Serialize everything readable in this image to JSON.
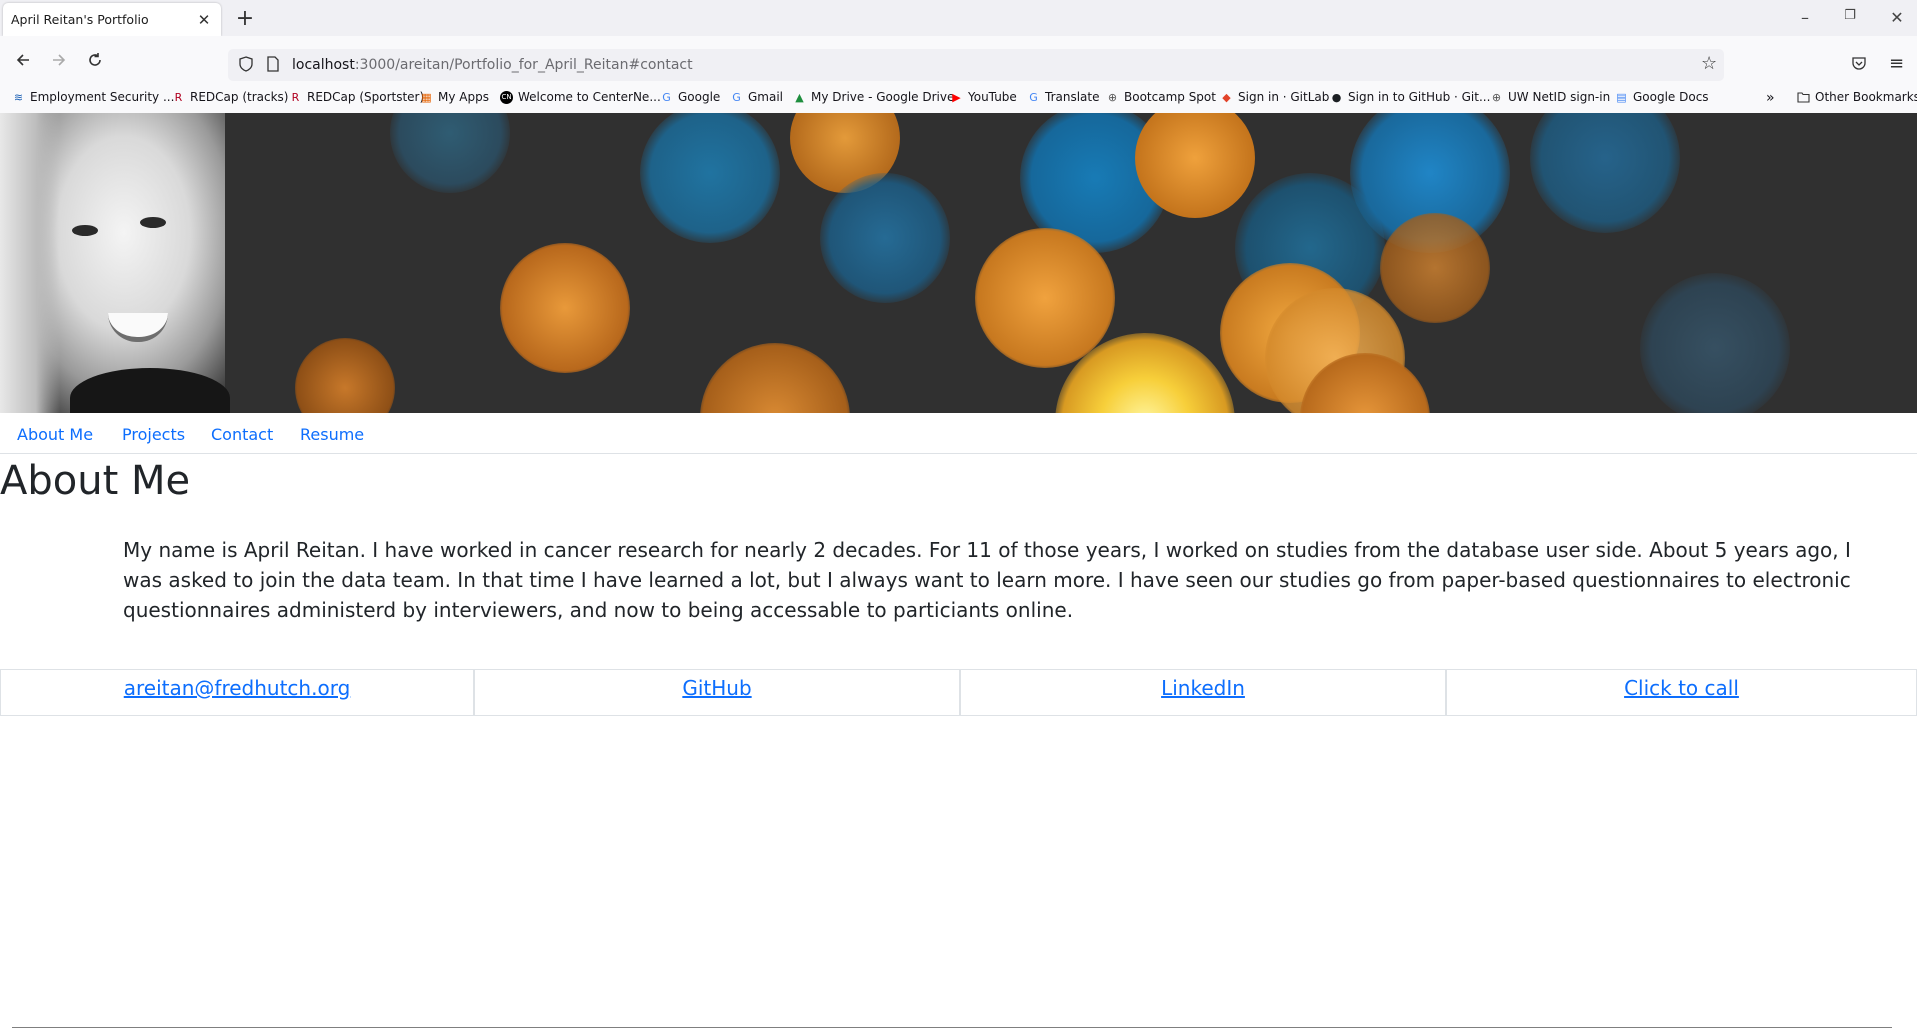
{
  "browser": {
    "tab_title": "April Reitan's Portfolio",
    "tab_close": "✕",
    "new_tab": "+",
    "url_host": "localhost",
    "url_rest": ":3000/areitan/Portfolio_for_April_Reitan#contact",
    "window_controls": [
      "–",
      "❐",
      "✕"
    ],
    "bookmarks": [
      {
        "label": "Employment Security ...",
        "icon": "≋",
        "color": "#1a5fb4"
      },
      {
        "label": "REDCap (tracks)",
        "icon": "R",
        "color": "#b00020"
      },
      {
        "label": "REDCap (Sportster)",
        "icon": "R",
        "color": "#b00020"
      },
      {
        "label": "My Apps",
        "icon": "▦",
        "color": "#e66100"
      },
      {
        "label": "Welcome to CenterNe...",
        "icon": "CN",
        "color": "#000000"
      },
      {
        "label": "Google",
        "icon": "G",
        "color": "#4285f4"
      },
      {
        "label": "Gmail",
        "icon": "G",
        "color": "#4285f4"
      },
      {
        "label": "My Drive - Google Drive",
        "icon": "▲",
        "color": "#1e8e3e"
      },
      {
        "label": "YouTube",
        "icon": "▶",
        "color": "#ff0000"
      },
      {
        "label": "Translate",
        "icon": "G",
        "color": "#4285f4"
      },
      {
        "label": "Bootcamp Spot",
        "icon": "⊕",
        "color": "#555555"
      },
      {
        "label": "Sign in · GitLab",
        "icon": "◆",
        "color": "#e24329"
      },
      {
        "label": "Sign in to GitHub · Git...",
        "icon": "●",
        "color": "#1b1f23"
      },
      {
        "label": "UW NetID sign-in",
        "icon": "⊕",
        "color": "#555555"
      },
      {
        "label": "Google Docs",
        "icon": "▤",
        "color": "#4285f4"
      }
    ],
    "overflow": "»",
    "other_bookmarks": "Other Bookmarks"
  },
  "nav": {
    "items": [
      "About Me",
      "Projects",
      "Contact",
      "Resume"
    ]
  },
  "about": {
    "title": "About Me",
    "text": "My name is April Reitan. I have worked in cancer research for nearly 2 decades. For 11 of those years, I worked on studies from the database user side. About 5 years ago, I was asked to join the data team. In that time I have learned a lot, but I always want to learn more. I have seen our studies go from paper-based questionnaires to electronic questionnaires administerd by interviewers, and now to being accessable to particiants online."
  },
  "contact": {
    "email": "areitan@fredhutch.org",
    "github": "GitHub",
    "linkedin": "LinkedIn",
    "call": "Click to call"
  },
  "colors": {
    "link": "#0d6efd",
    "text": "#212529",
    "hero_bg": "#303030"
  }
}
